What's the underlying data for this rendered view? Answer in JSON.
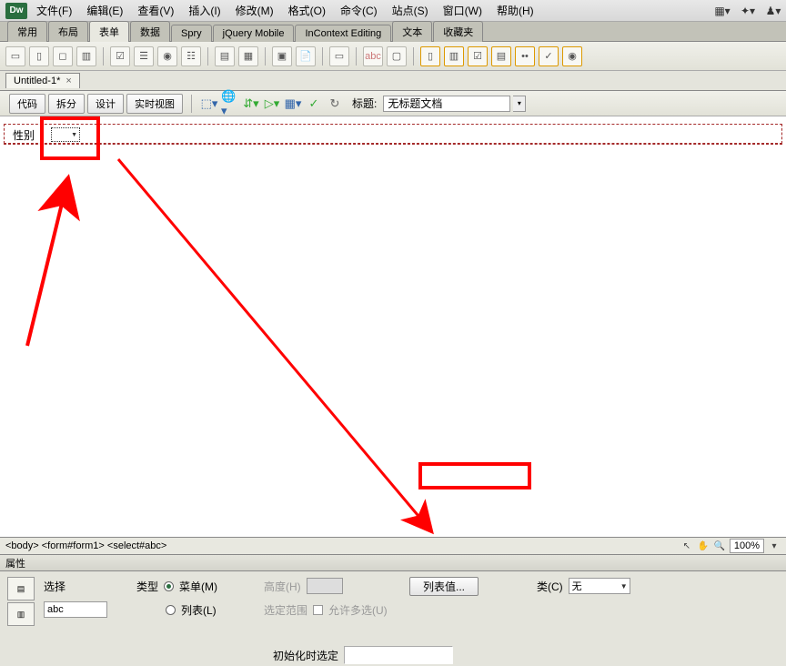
{
  "app": {
    "logo": "Dw"
  },
  "menubar": {
    "items": [
      "文件(F)",
      "编辑(E)",
      "查看(V)",
      "插入(I)",
      "修改(M)",
      "格式(O)",
      "命令(C)",
      "站点(S)",
      "窗口(W)",
      "帮助(H)"
    ]
  },
  "category_tabs": {
    "items": [
      "常用",
      "布局",
      "表单",
      "数据",
      "Spry",
      "jQuery Mobile",
      "InContext Editing",
      "文本",
      "收藏夹"
    ],
    "active_index": 2
  },
  "doc_tab": {
    "name": "Untitled-1*"
  },
  "view_toolbar": {
    "buttons": [
      "代码",
      "拆分",
      "设计",
      "实时视图"
    ],
    "title_label": "标题:",
    "title_value": "无标题文档"
  },
  "canvas": {
    "field_label": "性别"
  },
  "tag_selector": {
    "path": "<body> <form#form1> <select#abc>",
    "zoom": "100%"
  },
  "properties": {
    "header": "属性",
    "select_label": "选择",
    "id_value": "abc",
    "type_label": "类型",
    "type_menu": "菜单(M)",
    "type_list": "列表(L)",
    "height_label": "高度(H)",
    "range_label": "选定范围",
    "multi_label": "允许多选(U)",
    "list_values_btn": "列表值...",
    "class_label": "类(C)",
    "class_value": "无",
    "init_label": "初始化时选定"
  }
}
